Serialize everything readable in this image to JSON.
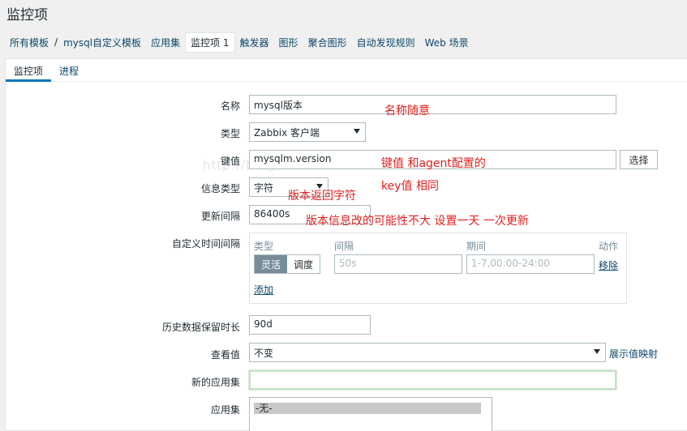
{
  "page": {
    "title": "监控项"
  },
  "breadcrumb": {
    "items": [
      {
        "label": "所有模板"
      },
      {
        "label": "mysql自定义模板"
      },
      {
        "label": "应用集"
      },
      {
        "label": "监控项 1"
      },
      {
        "label": "触发器"
      },
      {
        "label": "图形"
      },
      {
        "label": "聚合图形"
      },
      {
        "label": "自动发现规则"
      },
      {
        "label": "Web 场景"
      }
    ],
    "separator": "/"
  },
  "tabs": [
    {
      "label": "监控项"
    },
    {
      "label": "进程"
    }
  ],
  "form": {
    "name": {
      "label": "名称",
      "value": "mysql版本"
    },
    "type": {
      "label": "类型",
      "value": "Zabbix 客户端"
    },
    "key": {
      "label": "键值",
      "value": "mysqlm.version",
      "select_label": "选择"
    },
    "info_type": {
      "label": "信息类型",
      "value": "字符"
    },
    "interval": {
      "label": "更新间隔",
      "value": "86400s"
    },
    "custom_intervals": {
      "label": "自定义时间间隔",
      "col_type": "类型",
      "col_interval": "间隔",
      "col_period": "期间",
      "col_action": "动作",
      "mode_flexible": "灵活",
      "mode_scheduling": "调度",
      "interval_placeholder": "50s",
      "period_placeholder": "1-7,00:00-24:00",
      "remove_label": "移除",
      "add_label": "添加"
    },
    "history": {
      "label": "历史数据保留时长",
      "value": "90d"
    },
    "show_value": {
      "label": "查看值",
      "value": "不变",
      "mapping_link": "展示值映射"
    },
    "new_app": {
      "label": "新的应用集",
      "value": ""
    },
    "apps": {
      "label": "应用集",
      "options": [
        "-无-"
      ]
    }
  },
  "annotations": {
    "name_note": "名称随意",
    "key_note_1": "键值 和agent配置的",
    "key_note_2": "key值 相同",
    "type_note": "版本返回字符",
    "interval_note": "版本信息改的可能性不大 设置一天 一次更新"
  },
  "watermark": "http://blog.csdn.net/liaomin416100569"
}
